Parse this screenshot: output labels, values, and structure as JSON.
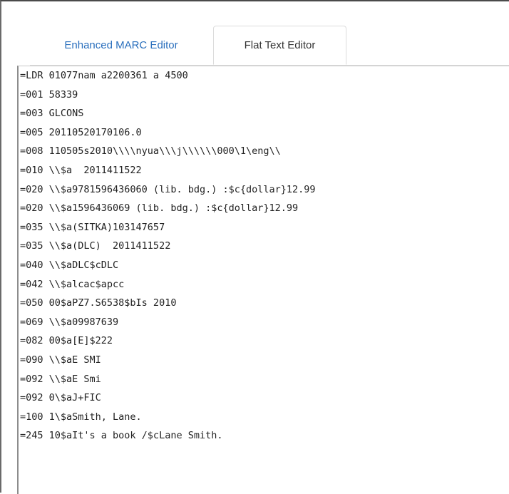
{
  "tabs": {
    "marc_label": "Enhanced MARC Editor",
    "flat_label": "Flat Text Editor"
  },
  "colors": {
    "link_tab": "#2a6fbd",
    "active_tab_text": "#333333",
    "editor_text": "#222222"
  },
  "editor": {
    "lines": [
      "=LDR 01077nam a2200361 a 4500",
      "=001 58339",
      "=003 GLCONS",
      "=005 20110520170106.0",
      "=008 110505s2010\\\\\\\\nyua\\\\\\j\\\\\\\\\\\\000\\1\\eng\\\\",
      "=010 \\\\$a  2011411522",
      "=020 \\\\$a9781596436060 (lib. bdg.) :$c{dollar}12.99",
      "=020 \\\\$a1596436069 (lib. bdg.) :$c{dollar}12.99",
      "=035 \\\\$a(SITKA)103147657",
      "=035 \\\\$a(DLC)  2011411522",
      "=040 \\\\$aDLC$cDLC",
      "=042 \\\\$alcac$apcc",
      "=050 00$aPZ7.S6538$bIs 2010",
      "=069 \\\\$a09987639",
      "=082 00$a[E]$222",
      "=090 \\\\$aE SMI",
      "=092 \\\\$aE Smi",
      "=092 0\\$aJ+FIC",
      "=100 1\\$aSmith, Lane.",
      "=245 10$aIt's a book /$cLane Smith."
    ]
  }
}
